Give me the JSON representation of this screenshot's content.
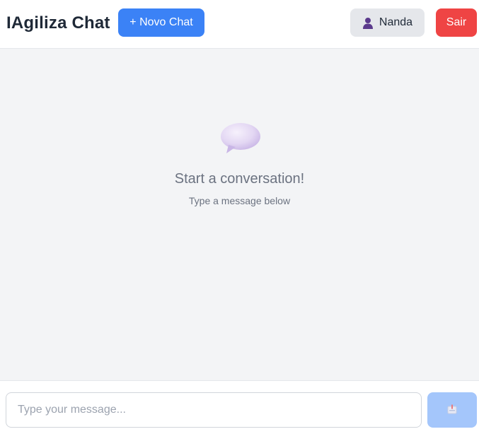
{
  "header": {
    "title": "IAgiliza Chat",
    "new_chat_label": "+ Novo Chat",
    "user_name": "Nanda",
    "logout_label": "Sair"
  },
  "empty_state": {
    "icon": "speech-bubble-icon",
    "title": "Start a conversation!",
    "subtitle": "Type a message below"
  },
  "composer": {
    "placeholder": "Type your message...",
    "value": "",
    "send_icon": "send-icon"
  },
  "colors": {
    "primary": "#3b82f6",
    "danger": "#ef4444",
    "send_disabled": "#a4c6fb",
    "chat_background": "#f3f4f6",
    "user_button_bg": "#e5e7eb"
  }
}
